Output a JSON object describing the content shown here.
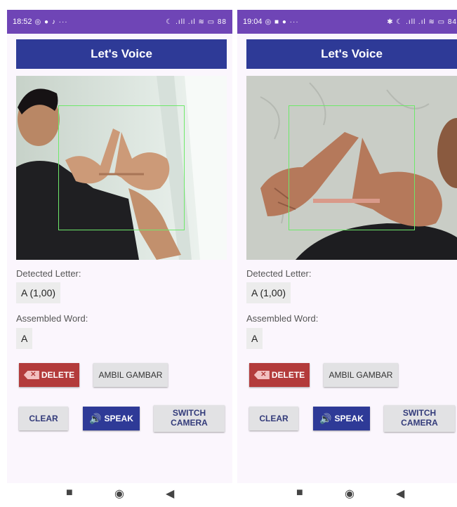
{
  "left_screen": {
    "status": {
      "time": "18:52",
      "left_icons": "◎ ● ♪ ···",
      "right_icons": "☾ .ıll .ıl ≋ ▭ 88"
    },
    "app_title": "Let's Voice",
    "detected_label": "Detected Letter:",
    "detected_value": "A (1,00)",
    "word_label": "Assembled Word:",
    "word_value": "A",
    "buttons": {
      "delete": "DELETE",
      "ambil": "AMBIL GAMBAR",
      "clear": "CLEAR",
      "speak": "SPEAK",
      "switch": "SWITCH CAMERA"
    }
  },
  "right_screen": {
    "status": {
      "time": "19:04",
      "left_icons": "◎ ■ ● ···",
      "right_icons": "✱ ☾ .ıll .ıl ≋ ▭ 84"
    },
    "app_title": "Let's Voice",
    "detected_label": "Detected Letter:",
    "detected_value": "A (1,00)",
    "word_label": "Assembled Word:",
    "word_value": "A",
    "buttons": {
      "delete": "DELETE",
      "ambil": "AMBIL GAMBAR",
      "clear": "CLEAR",
      "speak": "SPEAK",
      "switch": "SWITCH CAMERA"
    }
  },
  "icons": {
    "delete": "backspace-icon",
    "speak": "speaker-icon",
    "nav_recents": "recents-square-icon",
    "nav_home": "home-circle-icon",
    "nav_back": "back-triangle-icon"
  },
  "nav": {
    "recents": "■",
    "home": "◉",
    "back": "◀"
  },
  "colors": {
    "status_bar": "#6f45b6",
    "app_bar": "#2e3a97",
    "delete_button": "#b33b3b",
    "speak_button": "#2e3a97",
    "detection_box": "#6ee86a",
    "background": "#fbf6fd"
  }
}
